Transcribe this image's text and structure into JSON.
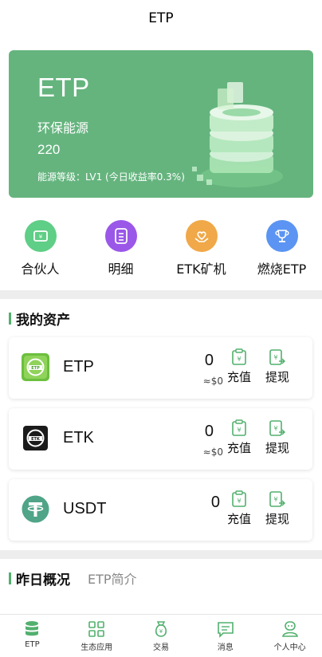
{
  "header": {
    "title": "ETP"
  },
  "hero": {
    "name": "ETP",
    "subtitle": "环保能源",
    "value": "220",
    "level_text": "能源等级：LV1 (今日收益率0.3%)"
  },
  "quick_actions": [
    {
      "label": "合伙人",
      "icon": "partner-icon",
      "color": "#5fce86"
    },
    {
      "label": "明细",
      "icon": "details-list-icon",
      "color": "#9a57e8"
    },
    {
      "label": "ETK矿机",
      "icon": "miner-heart-icon",
      "color": "#f0a848"
    },
    {
      "label": "燃烧ETP",
      "icon": "trophy-icon",
      "color": "#5b94f3"
    }
  ],
  "assets": {
    "title": "我的资产",
    "items": [
      {
        "name": "ETP",
        "amount": "0",
        "usd": "≈$0",
        "recharge": "充值",
        "withdraw": "提现"
      },
      {
        "name": "ETK",
        "amount": "0",
        "usd": "≈$0",
        "recharge": "充值",
        "withdraw": "提现"
      },
      {
        "name": "USDT",
        "amount": "0",
        "usd": "",
        "recharge": "充值",
        "withdraw": "提现"
      }
    ]
  },
  "overview": {
    "title": "昨日概况",
    "tab": "ETP简介"
  },
  "tabbar": [
    {
      "label": "ETP",
      "icon": "database-icon"
    },
    {
      "label": "生态应用",
      "icon": "grid-apps-icon"
    },
    {
      "label": "交易",
      "icon": "money-bag-icon"
    },
    {
      "label": "消息",
      "icon": "message-icon"
    },
    {
      "label": "个人中心",
      "icon": "user-icon"
    }
  ],
  "colors": {
    "brand_green": "#52b06e",
    "hero_bg": "#65b47e",
    "page_bg": "#ededed"
  }
}
